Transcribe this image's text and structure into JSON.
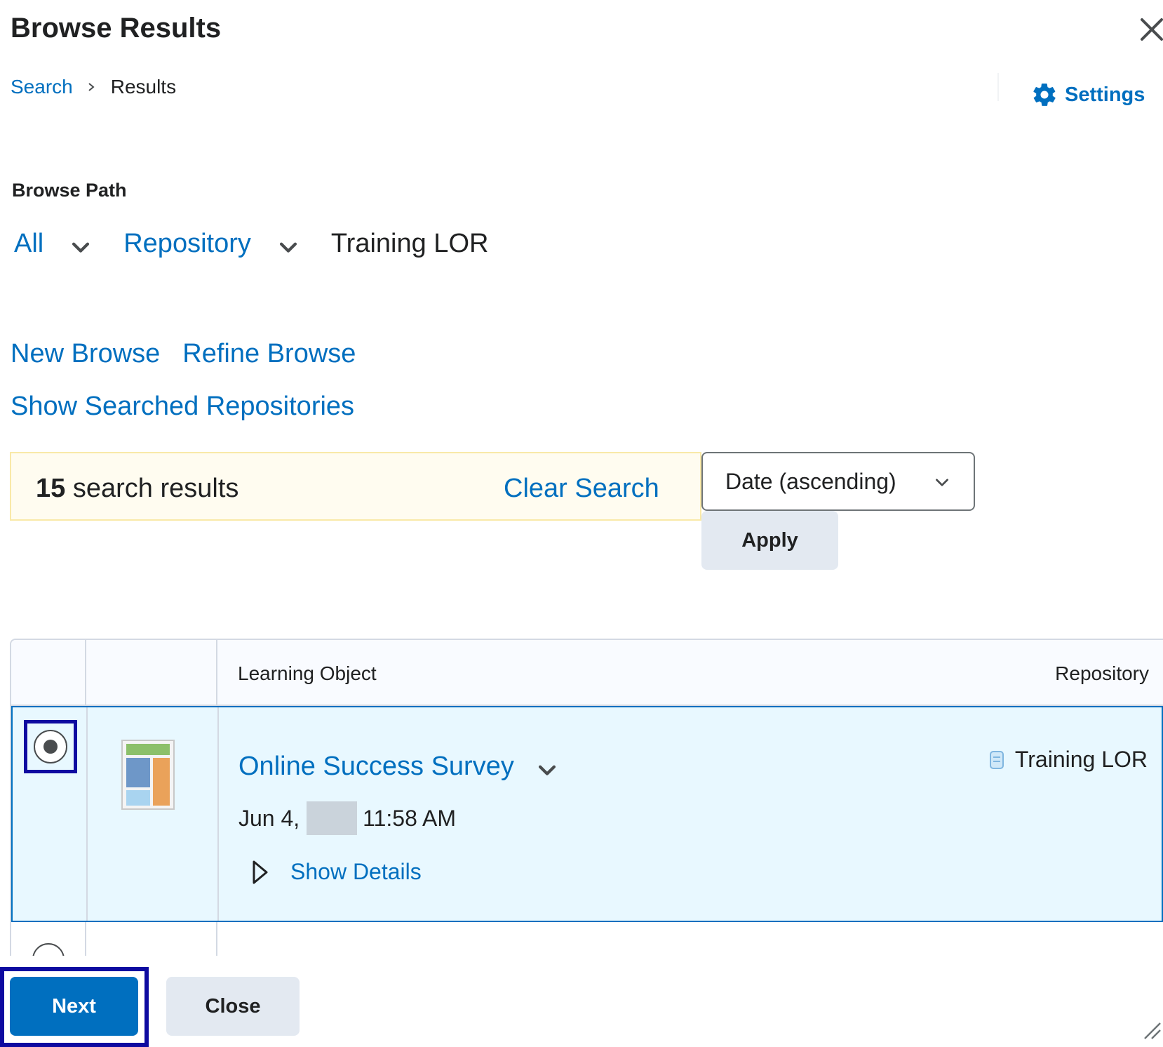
{
  "dialog": {
    "title": "Browse Results"
  },
  "breadcrumb": {
    "link": "Search",
    "current": "Results"
  },
  "settings": {
    "label": "Settings"
  },
  "browse_path": {
    "label": "Browse Path",
    "items": [
      "All",
      "Repository"
    ],
    "current": "Training LOR"
  },
  "actions": {
    "new_browse": "New Browse",
    "refine_browse": "Refine Browse",
    "show_repositories": "Show Searched Repositories"
  },
  "results": {
    "count": "15",
    "count_suffix": " search results",
    "clear_label": "Clear Search"
  },
  "sort": {
    "selected": "Date (ascending)",
    "apply_label": "Apply"
  },
  "table": {
    "headers": {
      "learning_object": "Learning Object",
      "repository": "Repository"
    },
    "rows": [
      {
        "title": "Online Success Survey",
        "date_prefix": "Jun 4,",
        "time": "11:58 AM",
        "details_label": "Show Details",
        "repository": "Training LOR",
        "selected": true
      }
    ]
  },
  "footer": {
    "next_label": "Next",
    "close_label": "Close"
  },
  "colors": {
    "link": "#006fbf",
    "primary_button": "#006fbf",
    "selected_row_bg": "#e8f8ff",
    "focus_ring": "#0e0aa0",
    "results_bar_bg": "#fffcf0"
  }
}
